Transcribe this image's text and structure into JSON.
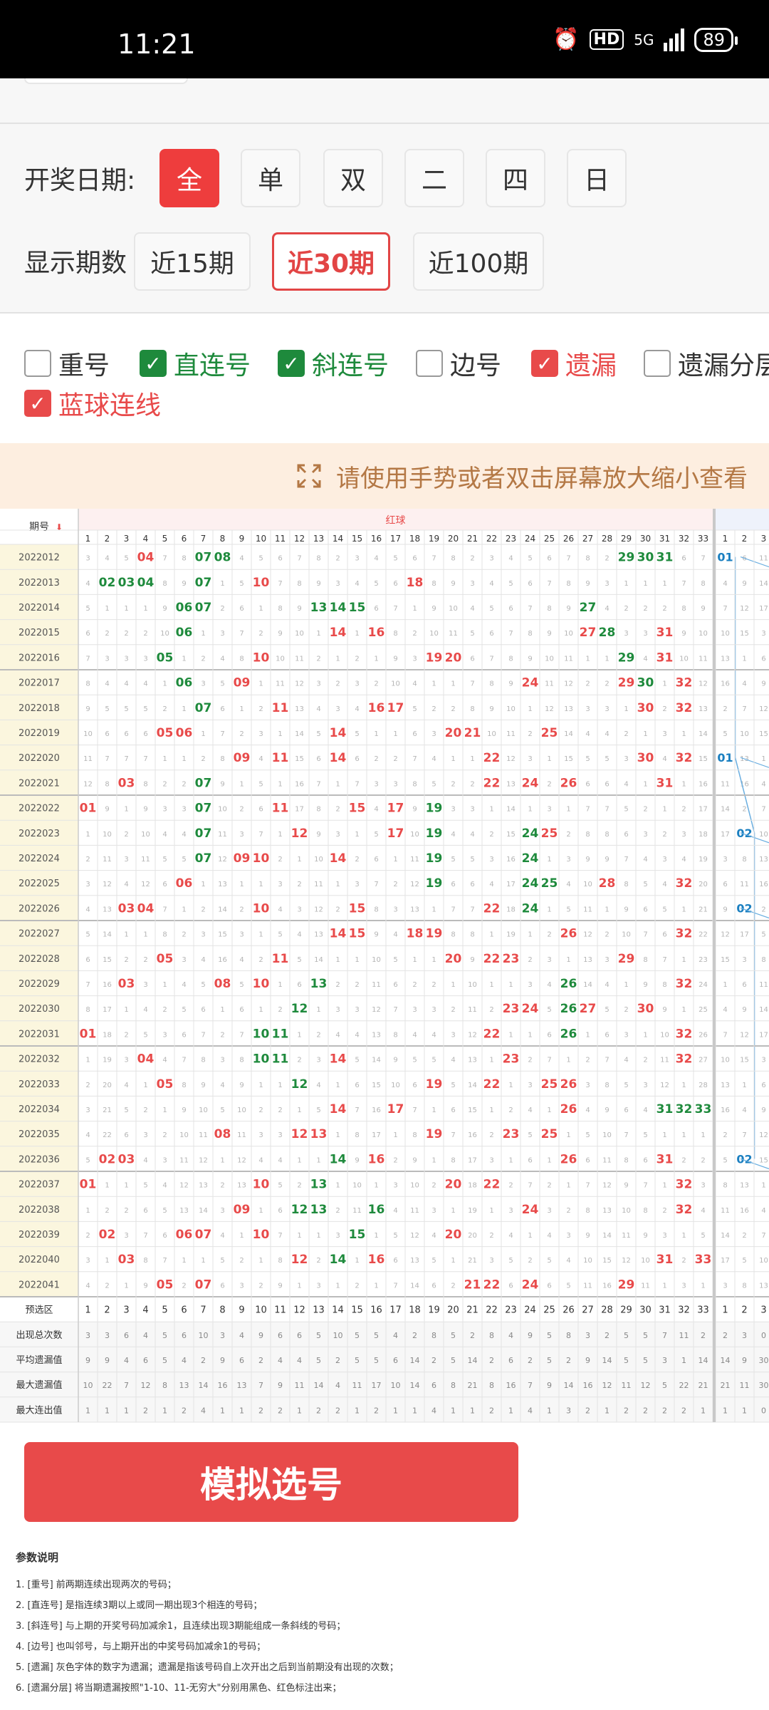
{
  "status_bar": {
    "time": "11:21",
    "network": "5G",
    "hd": "HD",
    "battery": "89"
  },
  "filters": {
    "date_label": "开奖日期:",
    "date_options": [
      "全",
      "单",
      "双",
      "二",
      "四",
      "日"
    ],
    "count_label": "显示期数",
    "count_options": [
      "近15期",
      "近30期",
      "近100期"
    ],
    "selected_date": "全",
    "selected_count": "近30期"
  },
  "options": [
    {
      "label": "重号",
      "checked": false,
      "color": "#333333"
    },
    {
      "label": "直连号",
      "checked": true,
      "color": "#1e8a3c"
    },
    {
      "label": "斜连号",
      "checked": true,
      "color": "#1e8a3c"
    },
    {
      "label": "边号",
      "checked": false,
      "color": "#333333"
    },
    {
      "label": "遗漏",
      "checked": true,
      "color": "#e84a4a"
    },
    {
      "label": "遗漏分层",
      "checked": false,
      "color": "#333333"
    },
    {
      "label": "蓝球连线",
      "checked": true,
      "color": "#e84a4a"
    }
  ],
  "banner": "请使用手势或者双击屏幕放大缩小查看",
  "table": {
    "period_header": "期号",
    "red_header": "红球",
    "red_numbers": [
      1,
      2,
      3,
      4,
      5,
      6,
      7,
      8,
      9,
      10,
      11,
      12,
      13,
      14,
      15,
      16,
      17,
      18,
      19,
      20,
      21,
      22,
      23,
      24,
      25,
      26,
      27,
      28,
      29,
      30,
      31,
      32,
      33
    ],
    "blue_numbers": [
      1,
      2,
      3
    ],
    "rows": [
      {
        "period": "2022012",
        "red": [
          4,
          7,
          8,
          29,
          30,
          31
        ],
        "green": [
          7,
          8,
          29,
          30,
          31
        ],
        "blue": "01"
      },
      {
        "period": "2022013",
        "red": [
          2,
          3,
          4,
          7,
          10,
          18
        ],
        "green": [
          2,
          3,
          4,
          7
        ],
        "blue": ""
      },
      {
        "period": "2022014",
        "red": [
          6,
          7,
          13,
          14,
          15,
          27
        ],
        "green": [
          6,
          7,
          13,
          14,
          15,
          27
        ],
        "blue": ""
      },
      {
        "period": "2022015",
        "red": [
          6,
          14,
          16,
          27,
          28,
          31
        ],
        "green": [
          6,
          28
        ],
        "blue": ""
      },
      {
        "period": "2022016",
        "red": [
          5,
          10,
          19,
          20,
          29,
          31
        ],
        "green": [
          5,
          29
        ],
        "blue": ""
      },
      {
        "period": "2022017",
        "red": [
          6,
          9,
          24,
          29,
          30,
          32
        ],
        "green": [
          6,
          30
        ],
        "blue": ""
      },
      {
        "period": "2022018",
        "red": [
          7,
          11,
          16,
          17,
          30,
          32
        ],
        "green": [
          7
        ],
        "blue": ""
      },
      {
        "period": "2022019",
        "red": [
          5,
          6,
          14,
          20,
          21,
          25
        ],
        "green": [],
        "blue": ""
      },
      {
        "period": "2022020",
        "red": [
          9,
          11,
          14,
          22,
          30,
          32
        ],
        "green": [],
        "blue": "01"
      },
      {
        "period": "2022021",
        "red": [
          3,
          7,
          22,
          24,
          26,
          31
        ],
        "green": [
          7
        ],
        "blue": ""
      },
      {
        "period": "2022022",
        "red": [
          1,
          7,
          11,
          15,
          17,
          19
        ],
        "green": [
          7,
          19
        ],
        "blue": ""
      },
      {
        "period": "2022023",
        "red": [
          7,
          12,
          17,
          19,
          24,
          25
        ],
        "green": [
          7,
          19,
          24
        ],
        "blue": "02"
      },
      {
        "period": "2022024",
        "red": [
          7,
          9,
          10,
          14,
          19,
          24
        ],
        "green": [
          7,
          19,
          24
        ],
        "blue": ""
      },
      {
        "period": "2022025",
        "red": [
          6,
          19,
          24,
          25,
          28,
          32
        ],
        "green": [
          19,
          24,
          25
        ],
        "blue": ""
      },
      {
        "period": "2022026",
        "red": [
          3,
          4,
          10,
          15,
          22,
          24
        ],
        "green": [
          24
        ],
        "blue": "02"
      },
      {
        "period": "2022027",
        "red": [
          14,
          15,
          18,
          19,
          26,
          32
        ],
        "green": [],
        "blue": ""
      },
      {
        "period": "2022028",
        "red": [
          5,
          11,
          20,
          22,
          23,
          29
        ],
        "green": [],
        "blue": ""
      },
      {
        "period": "2022029",
        "red": [
          3,
          8,
          10,
          13,
          26,
          32
        ],
        "green": [
          13,
          26
        ],
        "blue": ""
      },
      {
        "period": "2022030",
        "red": [
          12,
          23,
          24,
          26,
          27,
          30
        ],
        "green": [
          12,
          26
        ],
        "blue": ""
      },
      {
        "period": "2022031",
        "red": [
          1,
          10,
          11,
          22,
          26,
          32
        ],
        "green": [
          10,
          11,
          26
        ],
        "blue": ""
      },
      {
        "period": "2022032",
        "red": [
          4,
          10,
          11,
          14,
          23,
          32
        ],
        "green": [
          10,
          11
        ],
        "blue": ""
      },
      {
        "period": "2022033",
        "red": [
          5,
          12,
          19,
          22,
          25,
          26
        ],
        "green": [
          12
        ],
        "blue": ""
      },
      {
        "period": "2022034",
        "red": [
          14,
          17,
          26,
          31,
          32,
          33
        ],
        "green": [
          31,
          32,
          33
        ],
        "blue": ""
      },
      {
        "period": "2022035",
        "red": [
          8,
          12,
          13,
          19,
          23,
          25
        ],
        "green": [],
        "blue": ""
      },
      {
        "period": "2022036",
        "red": [
          2,
          3,
          14,
          16,
          26,
          31
        ],
        "green": [
          14
        ],
        "blue": "02"
      },
      {
        "period": "2022037",
        "red": [
          1,
          10,
          13,
          20,
          22,
          32
        ],
        "green": [
          13
        ],
        "blue": ""
      },
      {
        "period": "2022038",
        "red": [
          9,
          12,
          13,
          16,
          24,
          32
        ],
        "green": [
          12,
          13,
          16
        ],
        "blue": ""
      },
      {
        "period": "2022039",
        "red": [
          2,
          6,
          7,
          10,
          15,
          20
        ],
        "green": [
          15
        ],
        "blue": ""
      },
      {
        "period": "2022040",
        "red": [
          3,
          12,
          14,
          16,
          31,
          33
        ],
        "green": [
          14
        ],
        "blue": ""
      },
      {
        "period": "2022041",
        "red": [
          5,
          7,
          21,
          22,
          24,
          29
        ],
        "green": [],
        "blue": ""
      }
    ],
    "stat_rows": [
      {
        "label": "预选区",
        "values": [
          1,
          2,
          3,
          4,
          5,
          6,
          7,
          8,
          9,
          10,
          11,
          12,
          13,
          14,
          15,
          16,
          17,
          18,
          19,
          20,
          21,
          22,
          23,
          24,
          25,
          26,
          27,
          28,
          29,
          30,
          31,
          32,
          33
        ],
        "blue": [
          1,
          2,
          3
        ]
      },
      {
        "label": "出现总次数",
        "values": [
          3,
          3,
          6,
          4,
          5,
          6,
          10,
          3,
          4,
          9,
          6,
          6,
          5,
          10,
          5,
          5,
          4,
          2,
          8,
          5,
          2,
          8,
          4,
          9,
          5,
          8,
          3,
          2,
          5,
          5,
          7,
          11,
          2
        ],
        "blue": [
          2,
          3,
          0
        ]
      },
      {
        "label": "平均遗漏值",
        "values": [
          9,
          9,
          4,
          6,
          5,
          4,
          2,
          9,
          6,
          2,
          4,
          4,
          5,
          2,
          5,
          5,
          6,
          14,
          2,
          5,
          14,
          2,
          6,
          2,
          5,
          2,
          9,
          14,
          5,
          5,
          3,
          1,
          14
        ],
        "blue": [
          14,
          9,
          30
        ]
      },
      {
        "label": "最大遗漏值",
        "values": [
          10,
          22,
          7,
          12,
          8,
          13,
          14,
          16,
          13,
          7,
          9,
          11,
          14,
          4,
          11,
          17,
          10,
          14,
          6,
          8,
          21,
          8,
          16,
          7,
          9,
          14,
          16,
          12,
          11,
          12,
          5,
          22,
          21
        ],
        "blue": [
          21,
          11,
          30
        ]
      },
      {
        "label": "最大连出值",
        "values": [
          1,
          1,
          1,
          2,
          1,
          2,
          4,
          1,
          1,
          2,
          2,
          1,
          2,
          2,
          1,
          2,
          1,
          1,
          4,
          1,
          1,
          2,
          1,
          4,
          1,
          3,
          2,
          1,
          2,
          2,
          2,
          2,
          1
        ],
        "blue": [
          1,
          1,
          0
        ]
      }
    ]
  },
  "simulate_button": "模拟选号",
  "notes": {
    "title": "参数说明",
    "lines": [
      "1. [重号] 前两期连续出现两次的号码；",
      "2. [直连号] 是指连续3期以上或同一期出现3个相连的号码；",
      "3. [斜连号] 与上期的开奖号码加减余1，且连续出现3期能组成一条斜线的号码；",
      "4. [边号] 也叫邻号，与上期开出的中奖号码加减余1的号码；",
      "5. [遗漏] 灰色字体的数字为遗漏；遗漏是指该号码自上次开出之后到当前期没有出现的次数；",
      "6. [遗漏分层] 将当期遗漏按照\"1-10、11-无穷大\"分别用黑色、红色标注出来；"
    ]
  },
  "colors": {
    "red": "#e84a4a",
    "green": "#1e8a3c",
    "blue": "#1a7fc0",
    "miss": "#b5b5b5",
    "grid": "#e3e3e3",
    "period_bg": "#fbf6de",
    "header_bg": "#fdf0f0"
  }
}
